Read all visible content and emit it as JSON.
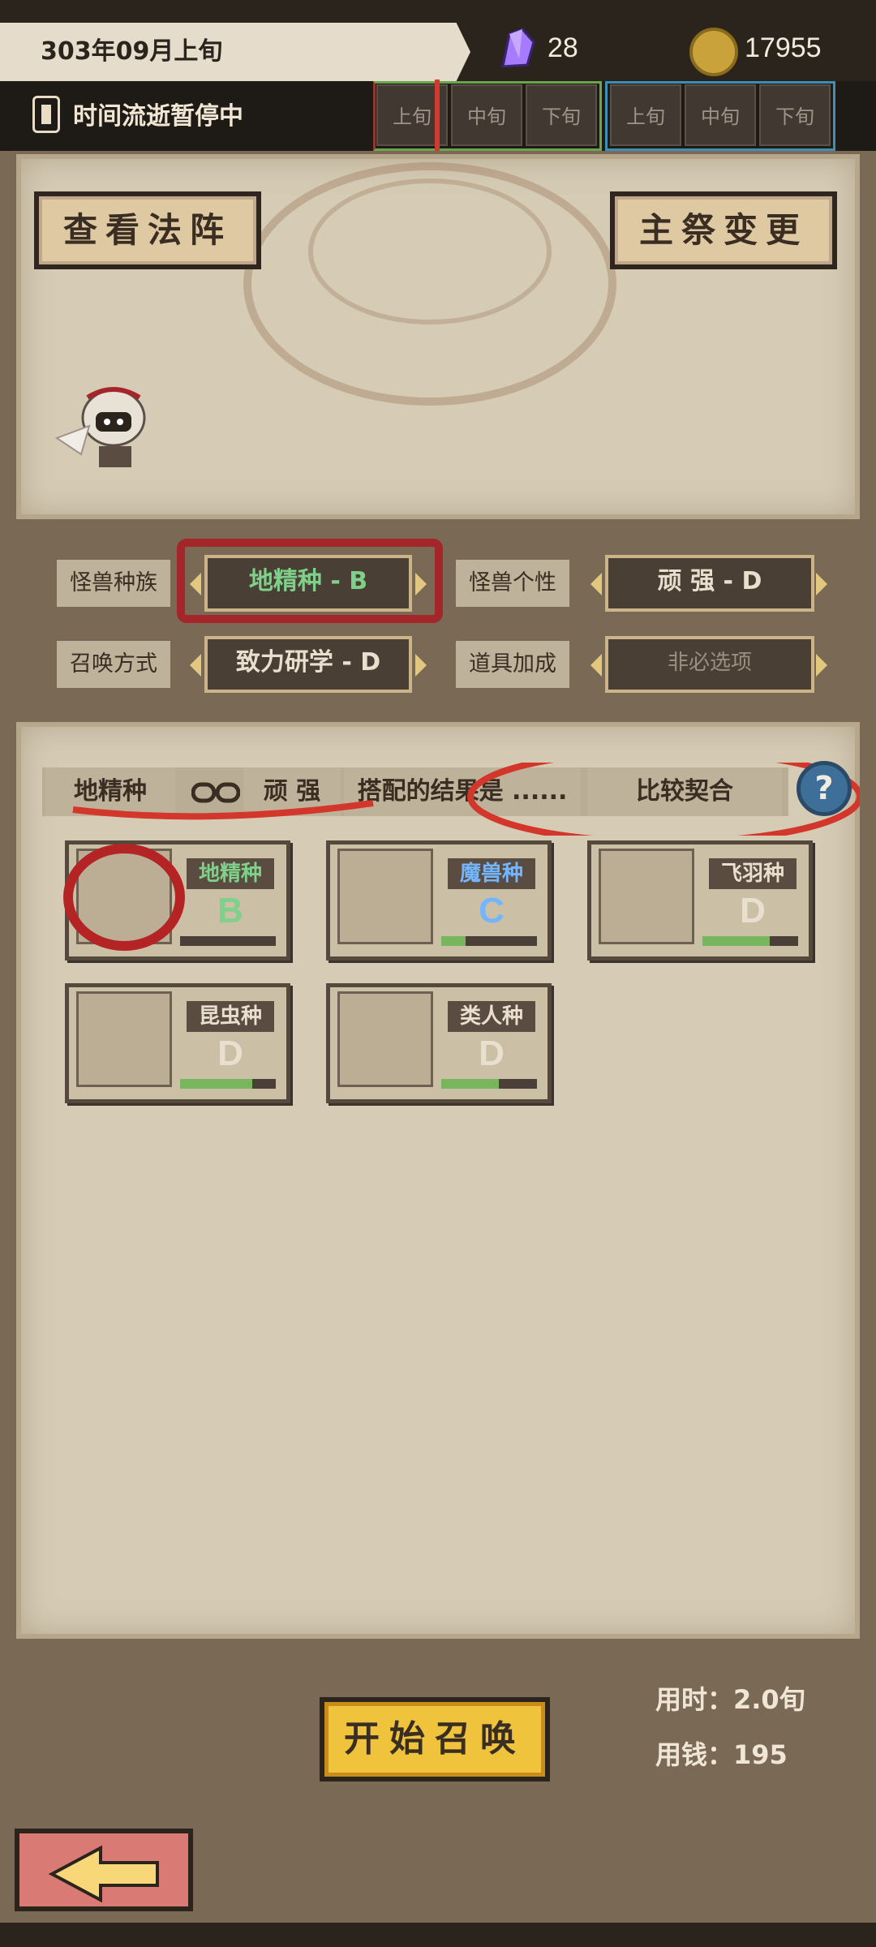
{
  "top": {
    "date": "303年09月上旬",
    "gems": "28",
    "coins": "17955"
  },
  "time": {
    "status": "时间流逝暂停中",
    "segments1": [
      "上旬",
      "中旬",
      "下旬"
    ],
    "segments2": [
      "上旬",
      "中旬",
      "下旬"
    ]
  },
  "buttons": {
    "view_formation": "查看法阵",
    "change_priest": "主祭变更",
    "start_summon": "开始召唤"
  },
  "selectors": {
    "species_label": "怪兽种族",
    "species_value": "地精种 - B",
    "personality_label": "怪兽个性",
    "personality_value": "顽 强 - D",
    "method_label": "召唤方式",
    "method_value": "致力研学 - D",
    "item_label": "道具加成",
    "item_value": "非必选项"
  },
  "pairing": {
    "left": "地精种",
    "right": "顽 强",
    "middle": "搭配的结果是 ......",
    "result": "比较契合"
  },
  "species_cards": [
    {
      "name": "地精种",
      "grade": "B",
      "progress": 0.0,
      "icon": "goblin-skull-icon",
      "name_color": "#7fd08a",
      "grade_color": "#7fd08a"
    },
    {
      "name": "魔兽种",
      "grade": "C",
      "progress": 0.25,
      "icon": "beast-icon",
      "name_color": "#73b6ff",
      "grade_color": "#73b6ff"
    },
    {
      "name": "飞羽种",
      "grade": "D",
      "progress": 0.7,
      "icon": "wings-icon",
      "name_color": "#e9dfcf",
      "grade_color": "#e9dfcf"
    },
    {
      "name": "昆虫种",
      "grade": "D",
      "progress": 0.75,
      "icon": "insect-icon",
      "name_color": "#e9dfcf",
      "grade_color": "#e9dfcf"
    },
    {
      "name": "类人种",
      "grade": "D",
      "progress": 0.6,
      "icon": "fist-icon",
      "name_color": "#e9dfcf",
      "grade_color": "#e9dfcf"
    }
  ],
  "cost": {
    "time": "用时：2.0旬",
    "money": "用钱：195"
  }
}
